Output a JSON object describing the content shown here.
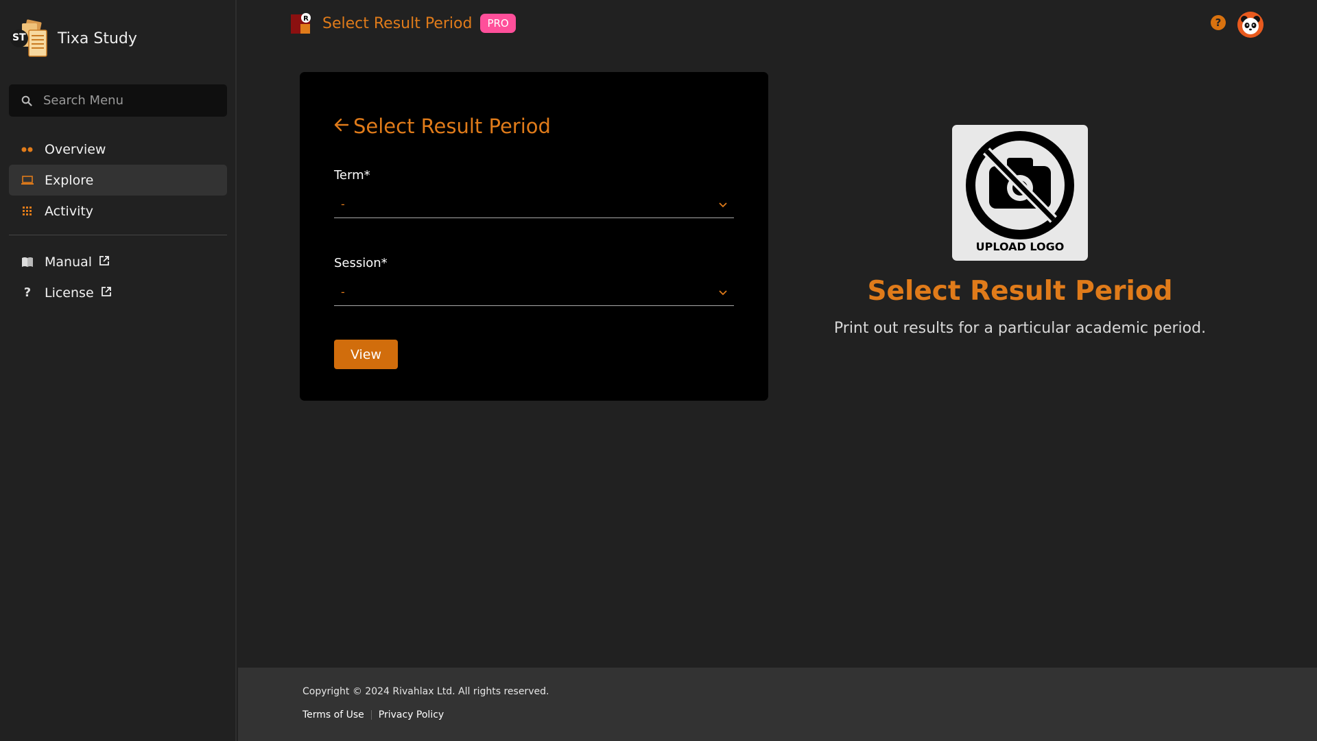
{
  "brand": {
    "initials": "ST",
    "name": "Tixa Study"
  },
  "search": {
    "placeholder": "Search Menu"
  },
  "nav": {
    "items": [
      {
        "label": "Overview",
        "icon": "dots-icon"
      },
      {
        "label": "Explore",
        "icon": "laptop-icon",
        "active": true
      },
      {
        "label": "Activity",
        "icon": "grid-icon"
      }
    ],
    "links": [
      {
        "label": "Manual",
        "icon": "book-icon"
      },
      {
        "label": "License",
        "icon": "question-icon"
      }
    ]
  },
  "header": {
    "title": "Select Result Period",
    "badge": "PRO",
    "help": "?"
  },
  "form": {
    "title": "Select Result Period",
    "term_label": "Term*",
    "term_value": "-",
    "session_label": "Session*",
    "session_value": "-",
    "view_label": "View"
  },
  "info": {
    "logo_caption": "UPLOAD LOGO",
    "title": "Select Result Period",
    "description": "Print out results for a particular academic period."
  },
  "footer": {
    "copyright": "Copyright © 2024 Rivahlax Ltd. All rights reserved.",
    "terms": "Terms of Use",
    "privacy": "Privacy Policy"
  },
  "colors": {
    "accent": "#e07b1a",
    "badge": "#ff4f9a",
    "button": "#d16d0c"
  }
}
